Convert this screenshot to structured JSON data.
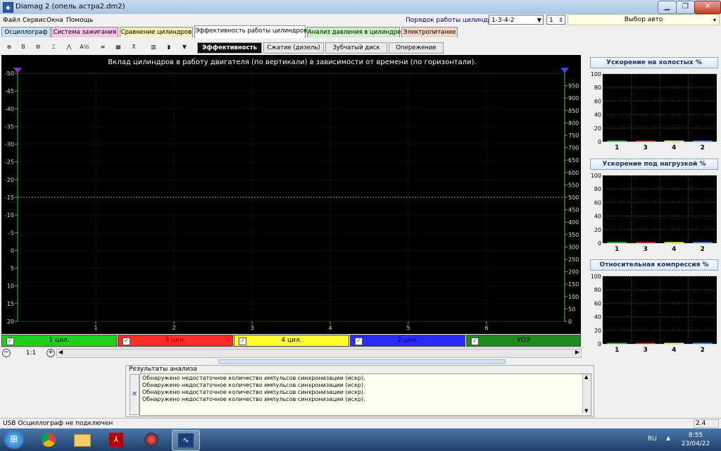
{
  "window": {
    "title": "Diamag 2 (опель астра2.dm2)",
    "min_icon": "minimize-icon",
    "max_icon": "maximize-icon",
    "close_label": "✕"
  },
  "menu": {
    "items": [
      "Файл",
      "Сервис",
      "Окна",
      "Помощь"
    ]
  },
  "cylinder_order": {
    "label": "Порядок работы цилиндров",
    "value": "1-3-4-2",
    "number": "1"
  },
  "car_select": {
    "value": "Выбор авто"
  },
  "tabs": [
    {
      "label": "Осциллограф",
      "color": "#c6e3f5"
    },
    {
      "label": "Система зажигания",
      "color": "#f5c6e8"
    },
    {
      "label": "Сравнение цилиндров",
      "color": "#f2f0b8"
    },
    {
      "label": "Эффективность работы цилиндров",
      "color": "#ffffff",
      "active": true
    },
    {
      "label": "Анализ давления в цилиндре",
      "color": "#c9f2c2"
    },
    {
      "label": "Электропитание",
      "color": "#f3d6c6"
    }
  ],
  "toolbar_icons": [
    "zoom-icon",
    "bold-icon",
    "gear-icon",
    "cursor-icon",
    "wave-icon",
    "alg-icon",
    "filter-icon",
    "grid-icon",
    "marker-icon",
    "stats-icon",
    "bars-icon",
    "funnel-icon"
  ],
  "toolbar_glyphs": {
    "alg": "Alg 1/2",
    "b": "B",
    "v903": "903"
  },
  "subtabs": [
    "Эффективность",
    "Сжатие (дизель)",
    "Зубчатый диск",
    "Опережение"
  ],
  "chart_data": {
    "type": "line",
    "title": "Вклад цилиндров в работу двигателя (по вертикали) в зависимости от времени (по горизонтали).",
    "x_ticks": [
      "1",
      "2",
      "3",
      "4",
      "5",
      "6"
    ],
    "xlim": [
      0,
      7
    ],
    "y_left_ticks": [
      "-50",
      "-45",
      "-40",
      "-35",
      "-30",
      "-25",
      "-20",
      "-15",
      "-10",
      "-5",
      "0",
      "5",
      "10",
      "15",
      "20"
    ],
    "ylim_left": [
      -50,
      20
    ],
    "y_right_ticks": [
      "950",
      "900",
      "850",
      "800",
      "750",
      "700",
      "650",
      "600",
      "550",
      "500",
      "450",
      "400",
      "350",
      "300",
      "250",
      "200",
      "150",
      "100",
      "50",
      "0"
    ],
    "ylim_right": [
      0,
      1000
    ],
    "reference_line": {
      "y": -15,
      "color": "#3fc6c6"
    },
    "grid": true,
    "series": []
  },
  "legend": [
    {
      "label": "1 цил.",
      "color": "#1fd11f",
      "text_color": "#000"
    },
    {
      "label": "3 цил.",
      "color": "#ff2a2a",
      "text_color": "#8a0000"
    },
    {
      "label": "4 цил.",
      "color": "#ffff30",
      "text_color": "#000"
    },
    {
      "label": "2 цил.",
      "color": "#2a2aff",
      "text_color": "#000060"
    },
    {
      "label": "УОЗ",
      "color": "#1f8a1f",
      "text_color": "#000"
    }
  ],
  "zoom": {
    "value": "1:1"
  },
  "results": {
    "title": "Результаты анализа",
    "lines": [
      "Обнаружено недостаточное количество импульсов синхронизации (искр).",
      "Обнаружено недостаточное количество импульсов синхронизации (искр).",
      "Обнаружено недостаточное количество импульсов синхронизации (искр).",
      "Обнаружено недостаточное количество импульсов синхронизации (искр)."
    ]
  },
  "side_charts": [
    {
      "title": "Ускорение на холостых %",
      "categories": [
        "1",
        "3",
        "4",
        "2"
      ],
      "values": [
        1,
        1,
        1,
        1
      ],
      "ylim": [
        0,
        100
      ],
      "y_ticks": [
        "100",
        "80",
        "60",
        "40",
        "20",
        "0"
      ]
    },
    {
      "title": "Ускорение под нагрузкой %",
      "categories": [
        "1",
        "3",
        "4",
        "2"
      ],
      "values": [
        1,
        1,
        1,
        1
      ],
      "ylim": [
        0,
        100
      ],
      "y_ticks": [
        "100",
        "80",
        "60",
        "40",
        "20",
        "0"
      ]
    },
    {
      "title": "Относительная компрессия %",
      "categories": [
        "1",
        "3",
        "4",
        "2"
      ],
      "values": [
        1,
        1,
        1,
        1
      ],
      "ylim": [
        0,
        100
      ],
      "y_ticks": [
        "100",
        "80",
        "60",
        "40",
        "20",
        "0"
      ]
    }
  ],
  "status": {
    "left": "USB Осциллограф не подключен",
    "right": "2.4"
  },
  "taskbar": {
    "lang": "RU",
    "time": "8:55",
    "date": "23/04/22"
  }
}
